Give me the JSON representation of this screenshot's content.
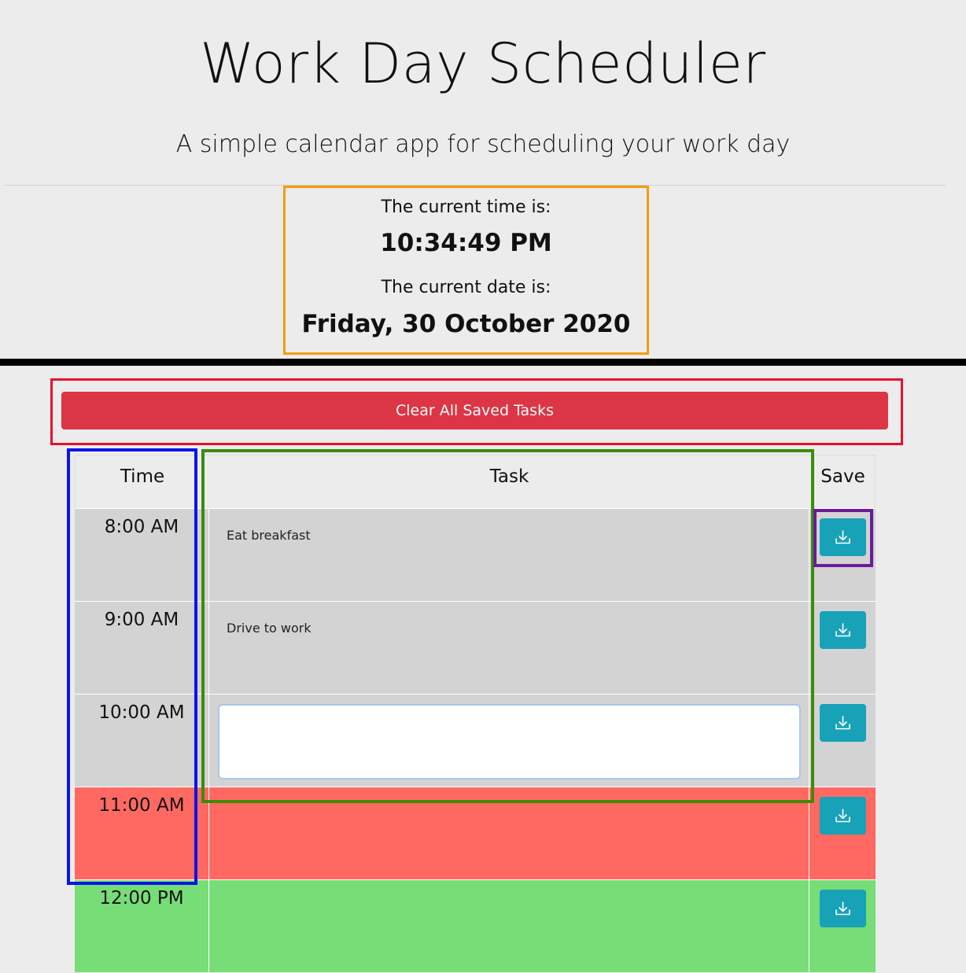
{
  "header": {
    "title": "Work Day Scheduler",
    "subtitle": "A simple calendar app for scheduling your work day"
  },
  "clock": {
    "time_label": "The current time is:",
    "time_value": "10:34:49 PM",
    "date_label": "The current date is:",
    "date_value": "Friday, 30 October 2020"
  },
  "actions": {
    "clear_label": "Clear All Saved Tasks"
  },
  "table": {
    "headers": {
      "time": "Time",
      "task": "Task",
      "save": "Save"
    },
    "rows": [
      {
        "time": "8:00 AM",
        "task": "Eat breakfast",
        "status": "past",
        "color": "#d3d3d3"
      },
      {
        "time": "9:00 AM",
        "task": "Drive to work",
        "status": "past",
        "color": "#d3d3d3"
      },
      {
        "time": "10:00 AM",
        "task": "",
        "status": "past",
        "color": "#d3d3d3"
      },
      {
        "time": "11:00 AM",
        "task": "",
        "status": "present",
        "color": "#ff6961"
      },
      {
        "time": "12:00 PM",
        "task": "",
        "status": "future",
        "color": "#77dd77"
      }
    ]
  },
  "icons": {
    "save": "download-icon"
  },
  "colors": {
    "clear_button": "#dc3545",
    "save_button": "#17a2b8",
    "clock_outline": "#f79a0f",
    "clear_outline": "#e8102e",
    "time_column_outline": "#0a14e6",
    "task_column_outline": "#3c8c0a",
    "save_button_outline": "#6a1b9a"
  }
}
